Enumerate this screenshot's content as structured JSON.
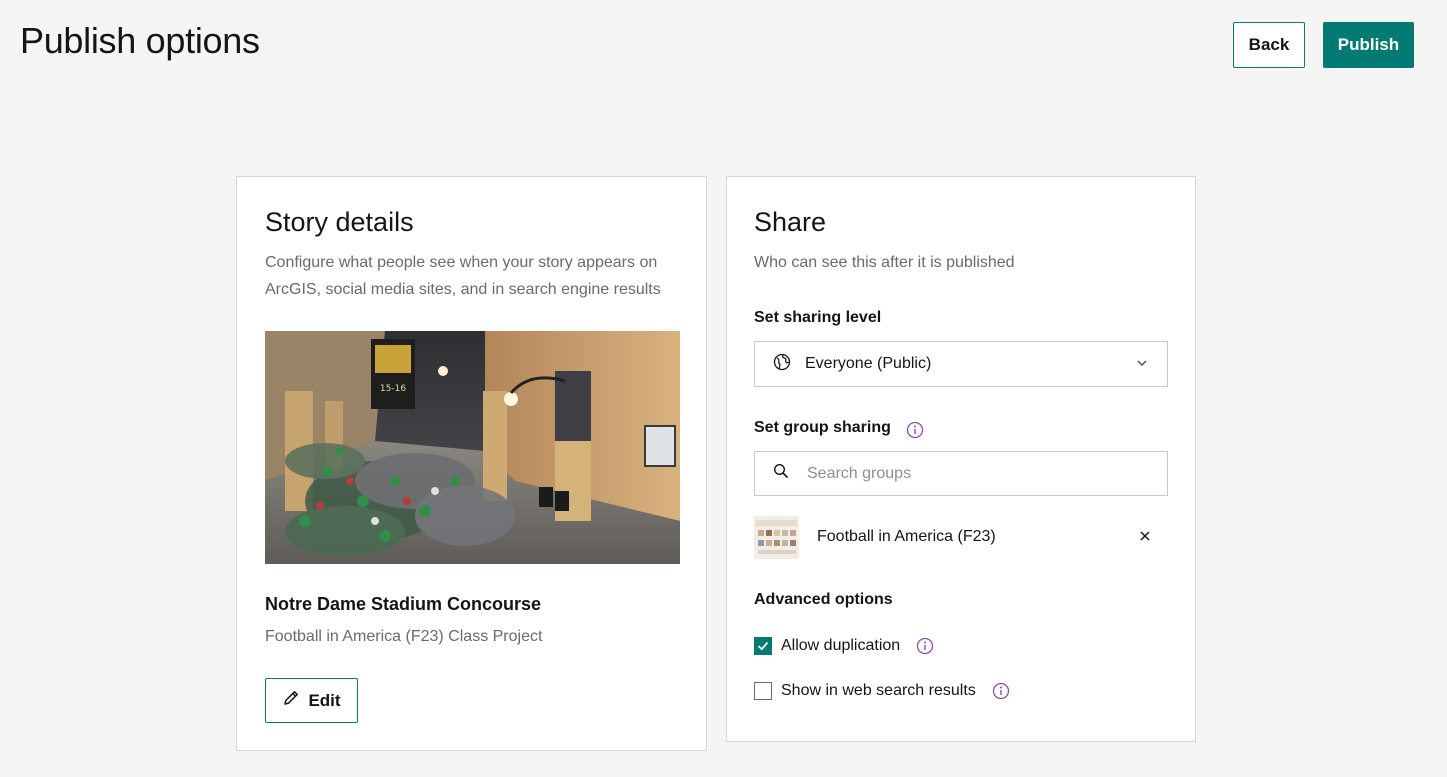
{
  "header": {
    "title": "Publish options",
    "back_label": "Back",
    "publish_label": "Publish"
  },
  "story_details": {
    "heading": "Story details",
    "description": "Configure what people see when your story appears on ArcGIS, social media sites, and in search engine results",
    "story_title": "Notre Dame Stadium Concourse",
    "story_subtitle": "Football in America (F23) Class Project",
    "edit_label": "Edit",
    "image_banner_text": "15-16"
  },
  "share": {
    "heading": "Share",
    "description": "Who can see this after it is published",
    "sharing_level_label": "Set sharing level",
    "sharing_level_value": "Everyone (Public)",
    "group_sharing_label": "Set group sharing",
    "search_placeholder": "Search groups",
    "groups": [
      {
        "name": "Football in America (F23)"
      }
    ],
    "advanced_label": "Advanced options",
    "options": [
      {
        "label": "Allow duplication",
        "checked": true
      },
      {
        "label": "Show in web search results",
        "checked": false
      }
    ]
  },
  "colors": {
    "accent": "#007a72",
    "info_icon": "#8f4aa6",
    "background": "#f4f5f4"
  },
  "icons": [
    "globe-icon",
    "chevron-down-icon",
    "info-icon",
    "search-icon",
    "close-icon",
    "pencil-icon",
    "checkmark-icon"
  ]
}
